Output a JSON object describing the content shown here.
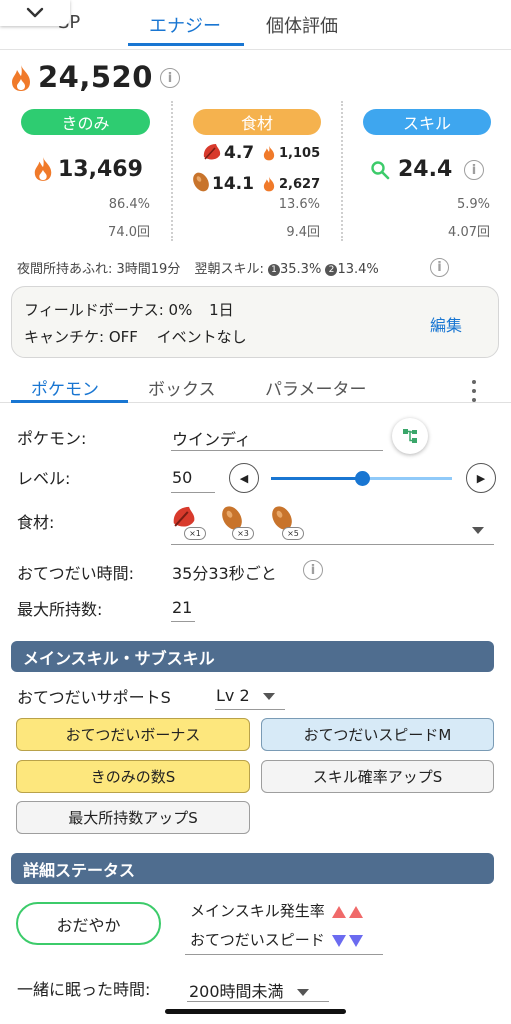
{
  "top_tabs": [
    {
      "label": "SP"
    },
    {
      "label": "エナジー"
    },
    {
      "label": "個体評価"
    }
  ],
  "total": {
    "value": "24,520"
  },
  "categories": {
    "berry": {
      "label": "きのみ",
      "energy": "13,469",
      "percent": "86.4%",
      "count": "74.0回",
      "color": "#2ecc71"
    },
    "ingredient": {
      "label": "食材",
      "items": [
        {
          "icon": "leaf-icon",
          "count": "4.7",
          "energy": "1,105"
        },
        {
          "icon": "bean-icon",
          "count": "14.1",
          "energy": "2,627"
        }
      ],
      "percent": "13.6%",
      "count": "9.4回",
      "color": "#f5b24e"
    },
    "skill": {
      "label": "スキル",
      "value": "24.4",
      "percent": "5.9%",
      "count": "4.07回",
      "color": "#3ea6ef"
    }
  },
  "night_note": {
    "overflow": "夜間所持あふれ: 3時間19分",
    "next_skill_label": "翌朝スキル:",
    "skill1_badge": "1",
    "skill1": "35.3%",
    "skill2_badge": "2",
    "skill2": "13.4%"
  },
  "field": {
    "bonus": "フィールドボーナス: 0%",
    "days": "1日",
    "candy": "キャンチケ: OFF",
    "event": "イベントなし",
    "edit_label": "編集"
  },
  "sub_tabs": [
    {
      "label": "ポケモン"
    },
    {
      "label": "ボックス"
    },
    {
      "label": "パラメーター"
    }
  ],
  "pokemon": {
    "label": "ポケモン:",
    "value": "ウインディ"
  },
  "level": {
    "label": "レベル:",
    "value": "50",
    "slider_fraction": 0.5,
    "prev_glyph": "◀",
    "next_glyph": "▶"
  },
  "ingredients": {
    "label": "食材:",
    "items": [
      {
        "icon": "leaf-icon",
        "count": "×1"
      },
      {
        "icon": "bean-icon",
        "count": "×3"
      },
      {
        "icon": "bean-icon",
        "count": "×5"
      }
    ]
  },
  "help_time": {
    "label": "おてつだい時間:",
    "value": "35分33秒ごと"
  },
  "max_carry": {
    "label": "最大所持数:",
    "value": "21"
  },
  "skills_section": {
    "title": "メインスキル・サブスキル",
    "main_skill": "おてつだいサポートS",
    "main_level": "Lv 2",
    "sub_skills": [
      {
        "label": "おてつだいボーナス",
        "style": "yellow"
      },
      {
        "label": "おてつだいスピードM",
        "style": "blue"
      },
      {
        "label": "きのみの数S",
        "style": "yellow"
      },
      {
        "label": "スキル確率アップS",
        "style": "gray"
      },
      {
        "label": "最大所持数アップS",
        "style": "gray"
      }
    ]
  },
  "detail_section": {
    "title": "詳細ステータス",
    "nature": "おだやか",
    "up_label": "メインスキル発生率",
    "down_label": "おてつだいスピード",
    "sleep_label": "一緒に眠った時間:",
    "sleep_value": "200時間未満"
  }
}
